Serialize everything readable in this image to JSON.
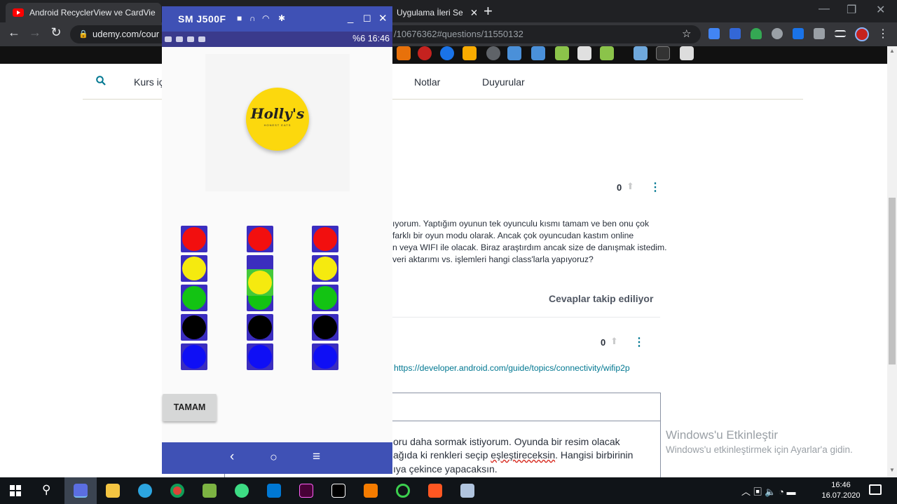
{
  "browser": {
    "tabs": [
      {
        "title": "Android RecyclerView ve CardVie",
        "active": true
      },
      {
        "title": "Uygulama İleri Se",
        "active": false
      }
    ],
    "new_tab_symbol": "+",
    "url_host": "udemy.com/cour",
    "url_rest": "/10676362#questions/11550132"
  },
  "course_tabs": [
    "Kurs iç",
    "Notlar",
    "Duyurular"
  ],
  "question": {
    "vote_count": "0",
    "lines": [
      "ıyorum. Yaptığım oyunun tek oyunculu kısmı tamam ve ben onu çok",
      "farklı bir oyun modu olarak. Ancak çok oyuncudan kastım online",
      "n veya WIFI ile olacak. Biraz araştırdım ancak size de danışmak istedim.",
      "veri aktarımı vs. işlemleri hangi class'larla yapıyoruz?"
    ],
    "follow_label": "Cevaplar takip ediliyor"
  },
  "answer": {
    "vote_count": "0",
    "link": "https://developer.android.com/guide/topics/connectivity/wifip2p"
  },
  "reply": {
    "line1": "oru daha sormak istiyorum. Oyunda bir resim olacak",
    "line2_a": "ağıda ki renkleri seçip ",
    "line2_b": "eşleştireceksin",
    "line2_c": ". Hangisi birbirinin",
    "line3": "ıya çekince yapacaksın."
  },
  "windows_watermark": {
    "title": "Windows'u Etkinleştir",
    "subtitle": "Windows'u etkinleştirmek için Ayarlar'a gidin."
  },
  "phone": {
    "device_name": "SM J500F",
    "status_right": "%6 16:46",
    "logo_text": "Holly's",
    "logo_sub": "HONEST EATS",
    "ok_button": "TAMAM",
    "colors": {
      "red": "#f20f0f",
      "yellow": "#f5ea0f",
      "green": "#13c313",
      "black": "#000000",
      "blue": "#0f0ff5",
      "slot": "#3b2dbf"
    },
    "columns": [
      [
        "red",
        "yellow",
        "green",
        "black",
        "blue"
      ],
      [
        "red",
        "empty",
        "green",
        "black",
        "blue"
      ],
      [
        "red",
        "yellow",
        "green",
        "black",
        "blue"
      ]
    ],
    "dragged_ball": "yellow"
  },
  "taskbar": {
    "time": "16:46",
    "date": "16.07.2020"
  }
}
